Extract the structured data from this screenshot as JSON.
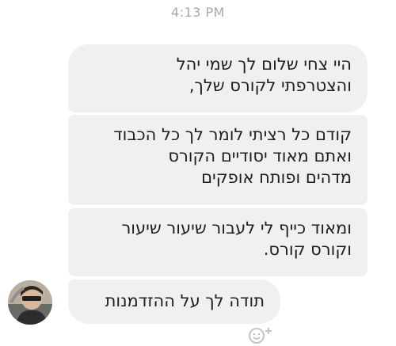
{
  "timestamp": "4:13 PM",
  "messages": [
    {
      "text": "היי צחי שלום לך שמי יהל\nוהצטרפתי לקורס שלך,"
    },
    {
      "text": "קודם כל רציתי לומר לך כל הכבוד\nואתם מאוד יסודיים הקורס\nמדהים ופותח אופקים"
    },
    {
      "text": "ומאוד כייף לי לעבור שיעור שיעור\nוקורס קורס."
    },
    {
      "text": "תודה לך על ההזדמנות"
    }
  ],
  "icons": {
    "avatar": "sender-avatar",
    "reaction": "add-reaction-icon"
  }
}
